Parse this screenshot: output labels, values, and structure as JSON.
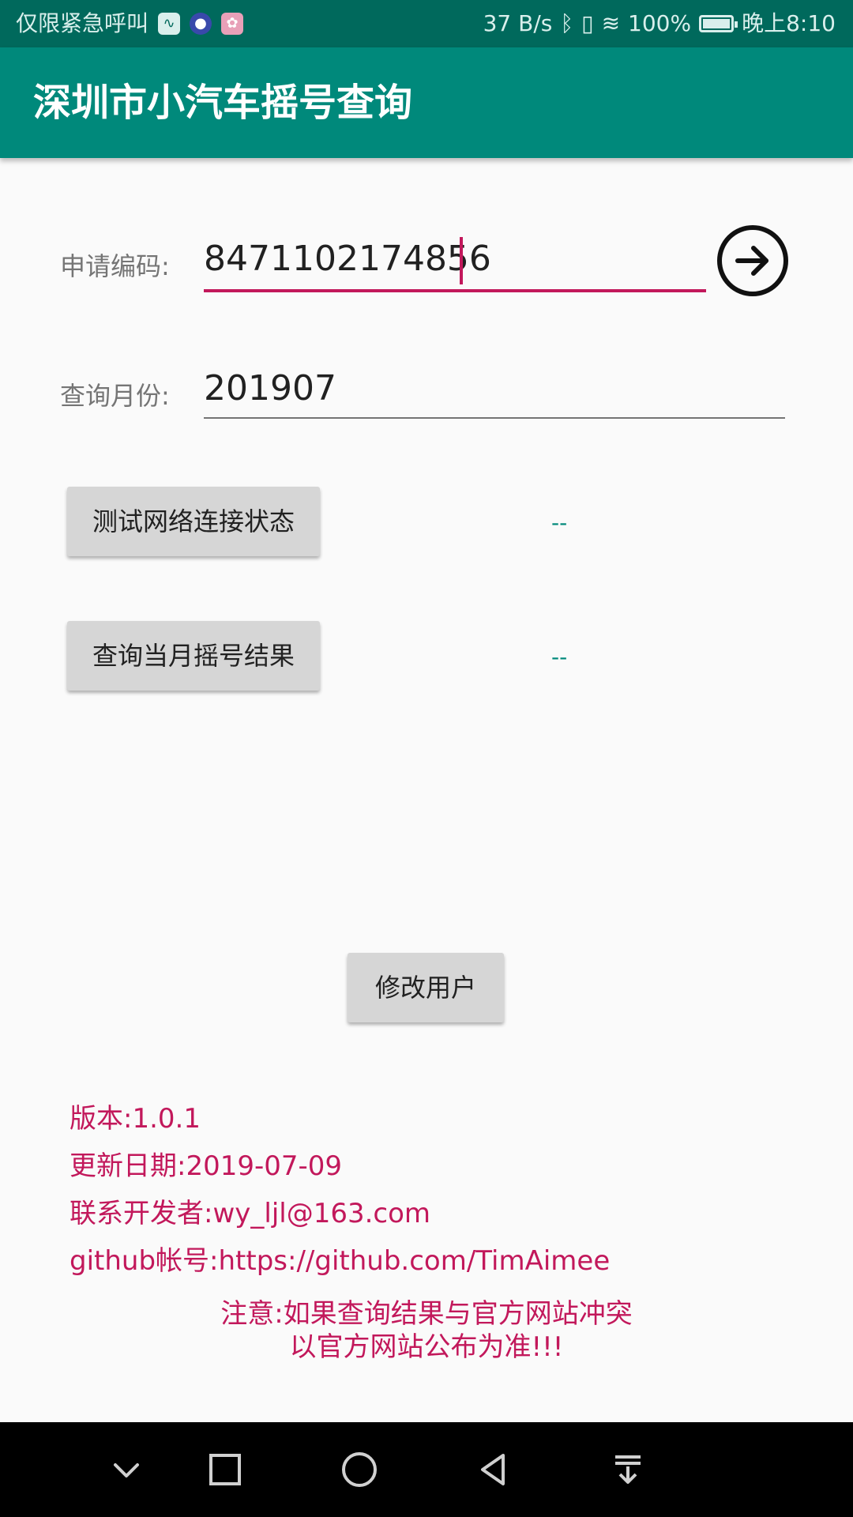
{
  "status_bar": {
    "carrier": "仅限紧急呼叫",
    "net_speed": "37 B/s",
    "battery": "100%",
    "time": "晚上8:10"
  },
  "app_bar": {
    "title": "深圳市小汽车摇号查询"
  },
  "form": {
    "apply_code_label": "申请编码:",
    "apply_code_value": "8471102174856",
    "query_month_label": "查询月份:",
    "query_month_value": "201907"
  },
  "actions": {
    "test_network_label": "测试网络连接状态",
    "test_network_result": "--",
    "query_result_label": "查询当月摇号结果",
    "query_result_value": "--",
    "modify_user_label": "修改用户"
  },
  "info": {
    "version": "版本:1.0.1",
    "update_date": "更新日期:2019-07-09",
    "contact": "联系开发者:wy_ljl@163.com",
    "github": "github帐号:https://github.com/TimAimee",
    "notice_line1": "注意:如果查询结果与官方网站冲突",
    "notice_line2": "以官方网站公布为准!!!"
  },
  "colors": {
    "primary": "#00897b",
    "primary_dark": "#00695c",
    "accent": "#c2185b"
  },
  "icons": {
    "go": "arrow-right-circle-icon",
    "nav": [
      "chevron-down-icon",
      "square-icon",
      "circle-icon",
      "triangle-back-icon",
      "download-icon"
    ]
  }
}
